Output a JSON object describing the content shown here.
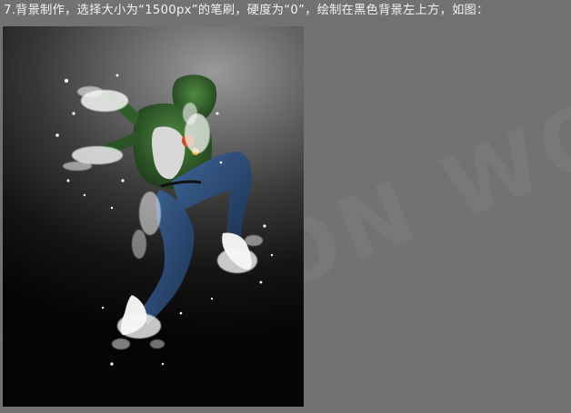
{
  "tutorial": {
    "step_caption": "7.背景制作，选择大小为“1500px”的笔刷，硬度为“0”，绘制在黑色背景左上方，如图："
  },
  "watermark": {
    "text": "EDITION WO",
    "color": "#7f7f7f"
  },
  "colors": {
    "page_background": "#727272",
    "caption_text": "#f2f2f2",
    "jacket_green": "#2f5e2b",
    "jeans_blue": "#2e4f7c",
    "splash_white": "#f4f4f4"
  },
  "icons": [
    "dancer-splash-photo"
  ]
}
